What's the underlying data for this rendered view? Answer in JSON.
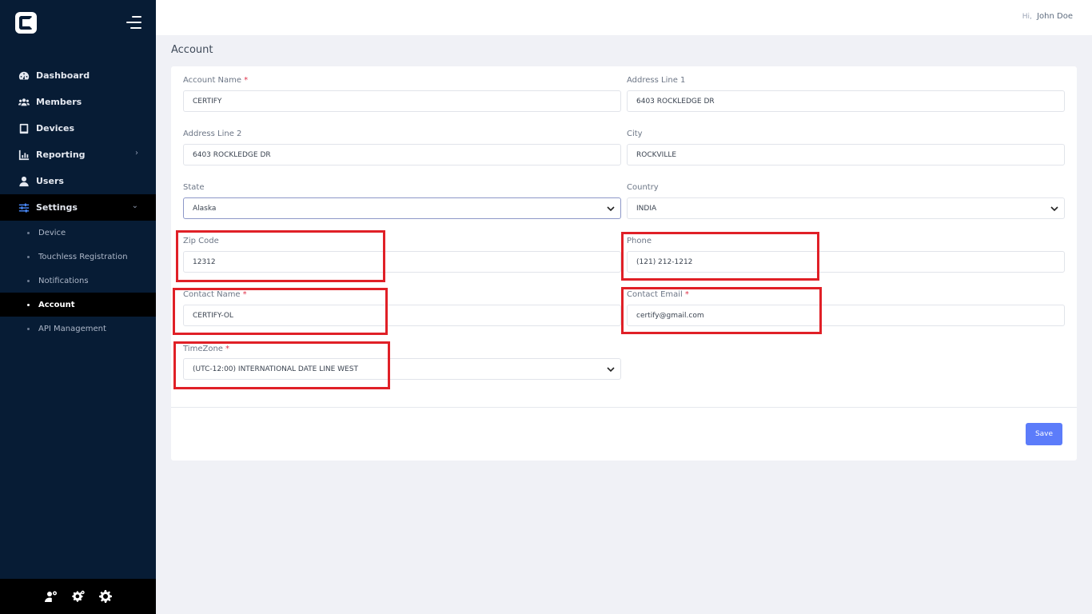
{
  "user": {
    "greeting_prefix": "Hi,",
    "name": "John Doe"
  },
  "sidebar": {
    "menu_icon": "hamburger-menu-icon",
    "logo_icon": "certify-logo-icon",
    "items": [
      {
        "label": "Dashboard",
        "icon": "dashboard-icon"
      },
      {
        "label": "Members",
        "icon": "members-icon"
      },
      {
        "label": "Devices",
        "icon": "devices-icon"
      },
      {
        "label": "Reporting",
        "icon": "reporting-icon",
        "chevron": "›"
      },
      {
        "label": "Users",
        "icon": "user-icon"
      },
      {
        "label": "Settings",
        "icon": "settings-sliders-icon",
        "chevron": "⌄"
      }
    ],
    "subitems": [
      {
        "label": "Device"
      },
      {
        "label": "Touchless Registration"
      },
      {
        "label": "Notifications"
      },
      {
        "label": "Account"
      },
      {
        "label": "API Management"
      }
    ],
    "footer_icons": [
      "user-settings-icon",
      "cogs-icon",
      "gear-icon"
    ]
  },
  "page": {
    "title": "Account"
  },
  "form": {
    "account_name": {
      "label": "Account Name",
      "required": "*",
      "value": "CERTIFY"
    },
    "address_line_1": {
      "label": "Address Line 1",
      "value": "6403 ROCKLEDGE DR"
    },
    "address_line_2": {
      "label": "Address Line 2",
      "value": "6403 ROCKLEDGE DR"
    },
    "city": {
      "label": "City",
      "value": "ROCKVILLE"
    },
    "state": {
      "label": "State",
      "value": "Alaska"
    },
    "country": {
      "label": "Country",
      "value": "INDIA"
    },
    "zip_code": {
      "label": "Zip Code",
      "value": "12312"
    },
    "phone": {
      "label": "Phone",
      "value": "(121) 212-1212"
    },
    "contact_name": {
      "label": "Contact Name",
      "required": "*",
      "value": "CERTIFY-OL"
    },
    "contact_email": {
      "label": "Contact Email",
      "required": "*",
      "value": "certify@gmail.com"
    },
    "timezone": {
      "label": "TimeZone",
      "required": "*",
      "value": "(UTC-12:00) INTERNATIONAL DATE LINE WEST"
    },
    "save_label": "Save"
  },
  "colors": {
    "sidebar_bg": "#071c35",
    "accent": "#5c7cfa",
    "highlight": "#e02027",
    "required": "#e0334b"
  }
}
